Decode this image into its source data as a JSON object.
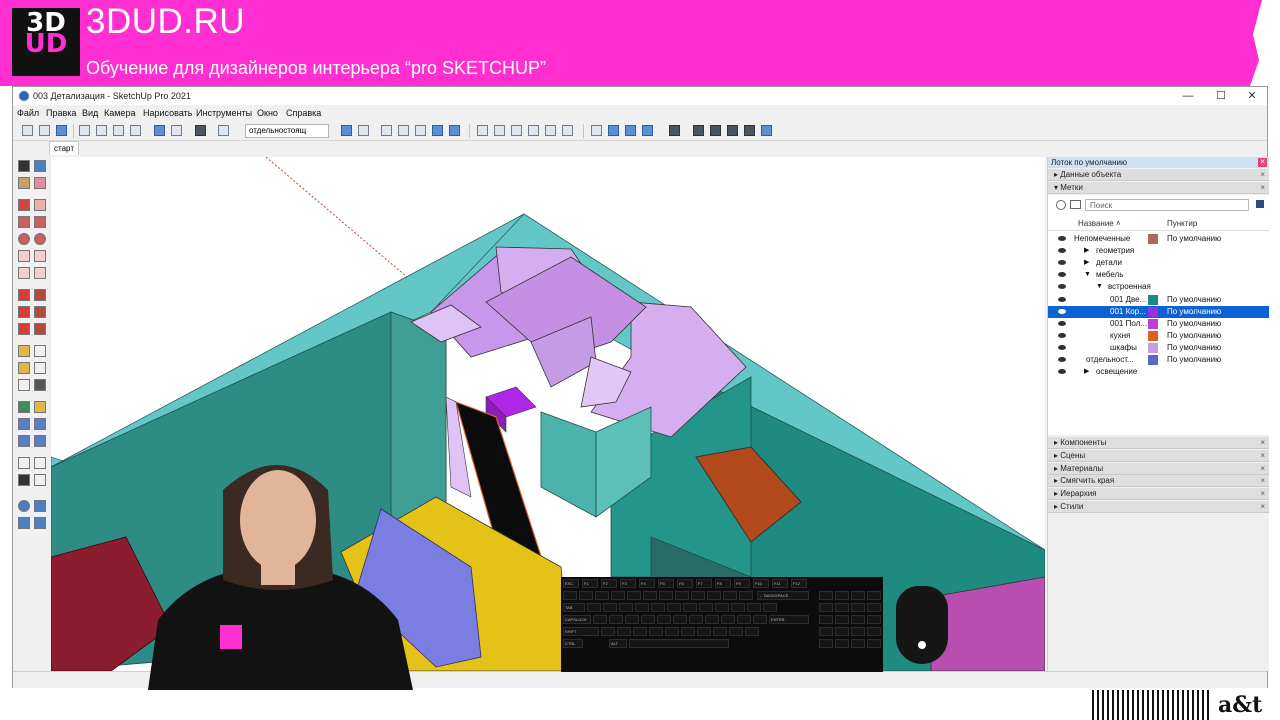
{
  "banner": {
    "logo_line1": "3D",
    "logo_line2": "UD",
    "site_name": "3DUD.RU",
    "tagline": "Обучение для дизайнеров интерьера “pro SKETCHUP”",
    "bg_color": "#ff2fd2"
  },
  "window": {
    "title": "003 Детализация - SketchUp Pro 2021",
    "controls": {
      "minimize": "—",
      "maximize": "☐",
      "close": "✕"
    }
  },
  "menu": [
    "Файл",
    "Правка",
    "Вид",
    "Камера",
    "Нарисовать",
    "Инструменты",
    "Окно",
    "Справка"
  ],
  "toolbar": {
    "active_tag": "отдельностоящ"
  },
  "scene_tabs": [
    "старт"
  ],
  "tray": {
    "title": "Лоток по умолчанию",
    "panels_top": [
      "Данные объекта",
      "Метки"
    ],
    "search_placeholder": "Поиск",
    "col_name": "Название",
    "col_dash": "Пунктир",
    "tags": [
      {
        "name": "Непомеченные",
        "color": "#b0685e",
        "dash": "По умолчанию",
        "indent": 0,
        "expander": ""
      },
      {
        "name": "геометрия",
        "color": "",
        "dash": "",
        "indent": 1,
        "expander": "▶"
      },
      {
        "name": "детали",
        "color": "",
        "dash": "",
        "indent": 1,
        "expander": "▶"
      },
      {
        "name": "мебель",
        "color": "",
        "dash": "",
        "indent": 1,
        "expander": "▼"
      },
      {
        "name": "встроенная",
        "color": "",
        "dash": "",
        "indent": 2,
        "expander": "▼"
      },
      {
        "name": "001 Две...",
        "color": "#1b8a84",
        "dash": "По умолчанию",
        "indent": 3,
        "expander": ""
      },
      {
        "name": "001 Кор...",
        "color": "#9b2fe0",
        "dash": "По умолчанию",
        "indent": 3,
        "expander": "",
        "selected": true
      },
      {
        "name": "001 Пол...",
        "color": "#c03fd6",
        "dash": "По умолчанию",
        "indent": 3,
        "expander": ""
      },
      {
        "name": "кухня",
        "color": "#d9631e",
        "dash": "По умолчанию",
        "indent": 3,
        "expander": ""
      },
      {
        "name": "шкафы",
        "color": "#c99be8",
        "dash": "По умолчанию",
        "indent": 3,
        "expander": ""
      },
      {
        "name": "отдельност...",
        "color": "#5a67c8",
        "dash": "По умолчанию",
        "indent": 1,
        "expander": ""
      },
      {
        "name": "освещение",
        "color": "",
        "dash": "",
        "indent": 1,
        "expander": "▶"
      }
    ],
    "panels_bottom": [
      "Компоненты",
      "Сцены",
      "Материалы",
      "Смягчить края",
      "Иерархия",
      "Стили"
    ]
  },
  "keyboard": {
    "keys_row1": [
      "ESC",
      "F1",
      "F2",
      "F3",
      "F4",
      "F5",
      "F6",
      "F7",
      "F8",
      "F9",
      "F10",
      "F11",
      "F12"
    ],
    "backspace": "← BACKSPACE",
    "caps": "CAPSLOCK",
    "shift": "SHIFT",
    "tab": "TAB",
    "ctrl": "CTRL",
    "alt": "ALT",
    "enter": "ENTER"
  },
  "credit": "a&t"
}
